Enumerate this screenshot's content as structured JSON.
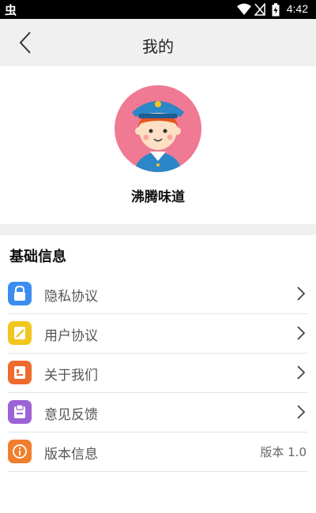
{
  "status_bar": {
    "left_icon": "bug-icon",
    "time": "4:42",
    "icons": [
      "wifi-icon",
      "signal-off-icon",
      "battery-icon"
    ]
  },
  "app_bar": {
    "title": "我的",
    "back_icon": "back-arrow-icon"
  },
  "profile": {
    "avatar": "police-avatar",
    "username": "沸腾味道"
  },
  "section": {
    "title": "基础信息"
  },
  "list": [
    {
      "label": "隐私协议",
      "icon": "lock-icon",
      "icon_color": "#3c8df0",
      "has_chevron": true
    },
    {
      "label": "用户协议",
      "icon": "edit-icon",
      "icon_color": "#f2c51f",
      "has_chevron": true
    },
    {
      "label": "关于我们",
      "icon": "info-card-icon",
      "icon_color": "#ef6a2e",
      "has_chevron": true
    },
    {
      "label": "意见反馈",
      "icon": "feedback-icon",
      "icon_color": "#9b63d6",
      "has_chevron": true
    },
    {
      "label": "版本信息",
      "icon": "info-circle-icon",
      "icon_color": "#f07f2d",
      "has_chevron": false,
      "value": "版本 1.0"
    }
  ]
}
